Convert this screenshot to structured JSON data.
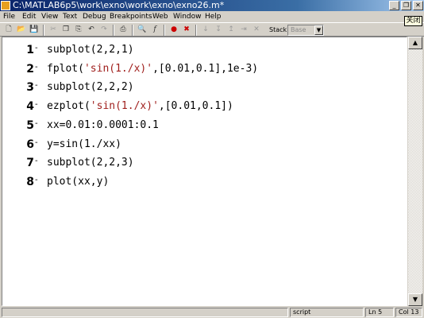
{
  "window": {
    "title": "C:\\MATLAB6p5\\work\\exno\\work\\exno\\exno26.m*",
    "minimize_glyph": "_",
    "maximize_glyph": "❐",
    "close_glyph": "✕",
    "tooltip": "关闭"
  },
  "menu": {
    "items": [
      "File",
      "Edit",
      "View",
      "Text",
      "Debug",
      "Breakpoints",
      "Web",
      "Window",
      "Help"
    ]
  },
  "toolbar": {
    "icons": [
      "new-file-icon",
      "open-folder-icon",
      "save-icon",
      "cut-icon",
      "copy-icon",
      "paste-icon",
      "undo-icon",
      "redo-icon",
      "print-icon",
      "find-icon",
      "function-icon",
      "set-breakpoint-icon",
      "clear-breakpoint-icon",
      "step-icon",
      "step-in-icon",
      "step-out-icon",
      "continue-icon",
      "exit-debug-icon"
    ],
    "stack_label": "Stack:",
    "stack_value": "Base"
  },
  "editor": {
    "lines": [
      {
        "num": "1",
        "segments": [
          {
            "text": "subplot(2,2,1)",
            "kind": "code"
          }
        ]
      },
      {
        "num": "2",
        "segments": [
          {
            "text": "fplot(",
            "kind": "code"
          },
          {
            "text": "'sin(1./x)'",
            "kind": "string"
          },
          {
            "text": ",[0.01,0.1],1e-3)",
            "kind": "code"
          }
        ]
      },
      {
        "num": "3",
        "segments": [
          {
            "text": "subplot(2,2,2)",
            "kind": "code"
          }
        ]
      },
      {
        "num": "4",
        "segments": [
          {
            "text": "ezplot(",
            "kind": "code"
          },
          {
            "text": "'sin(1./x)'",
            "kind": "string"
          },
          {
            "text": ",[0.01,0.1])",
            "kind": "code"
          }
        ]
      },
      {
        "num": "5",
        "segments": [
          {
            "text": "xx=0.01:0.0001:0.1",
            "kind": "code"
          }
        ]
      },
      {
        "num": "6",
        "segments": [
          {
            "text": "y=sin(1./xx)",
            "kind": "code"
          }
        ]
      },
      {
        "num": "7",
        "segments": [
          {
            "text": "subplot(2,2,3)",
            "kind": "code"
          }
        ]
      },
      {
        "num": "8",
        "segments": [
          {
            "text": "plot(xx,y)",
            "kind": "code"
          }
        ]
      }
    ],
    "line_marker": "-"
  },
  "scrollbar": {
    "up_glyph": "▲",
    "down_glyph": "▼"
  },
  "status": {
    "mode": "script",
    "line": "Ln 5",
    "col": "Col 13"
  },
  "colors": {
    "string": "#a0201e",
    "titlebar": "#0a246a"
  }
}
